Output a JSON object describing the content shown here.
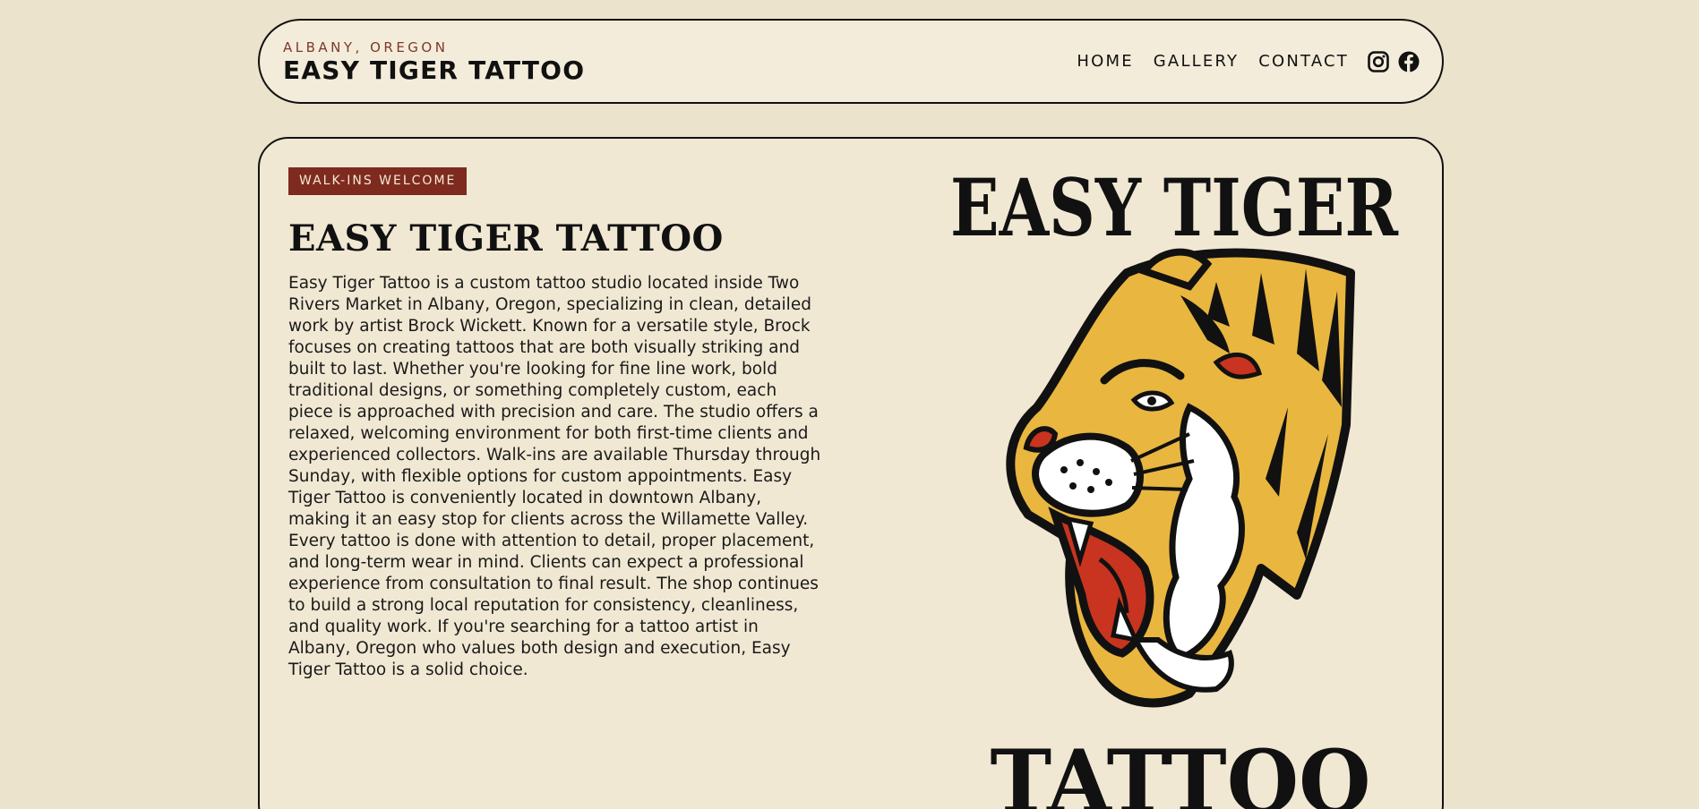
{
  "header": {
    "location": "ALBANY, OREGON",
    "brand_name": "EASY TIGER TATTOO",
    "nav": [
      {
        "label": "HOME"
      },
      {
        "label": "GALLERY"
      },
      {
        "label": "CONTACT"
      }
    ],
    "social_icons": [
      "instagram-icon",
      "facebook-icon"
    ]
  },
  "hero": {
    "badge": "WALK-INS WELCOME",
    "title": "EASY TIGER TATTOO",
    "description": "Easy Tiger Tattoo is a custom tattoo studio located inside Two Rivers Market in Albany, Oregon, specializing in clean, detailed work by artist Brock Wickett. Known for a versatile style, Brock focuses on creating tattoos that are both visually striking and built to last. Whether you're looking for fine line work, bold traditional designs, or something completely custom, each piece is approached with precision and care. The studio offers a relaxed, welcoming environment for both first-time clients and experienced collectors. Walk-ins are available Thursday through Sunday, with flexible options for custom appointments. Easy Tiger Tattoo is conveniently located in downtown Albany, making it an easy stop for clients across the Willamette Valley. Every tattoo is done with attention to detail, proper placement, and long-term wear in mind. Clients can expect a professional experience from consultation to final result. The shop continues to build a strong local reputation for consistency, cleanliness, and quality work. If you're searching for a tattoo artist in Albany, Oregon who values both design and execution, Easy Tiger Tattoo is a solid choice.",
    "logo_top_word": "EASY TIGER",
    "logo_bottom_word": "TATTOO"
  },
  "colors": {
    "page_bg": "#ebe3cb",
    "card_bg": "#f1e8d3",
    "badge_bg": "#7e2a1e",
    "tiger_yellow": "#e9b640",
    "tiger_red": "#c8341f",
    "ink": "#111111"
  }
}
